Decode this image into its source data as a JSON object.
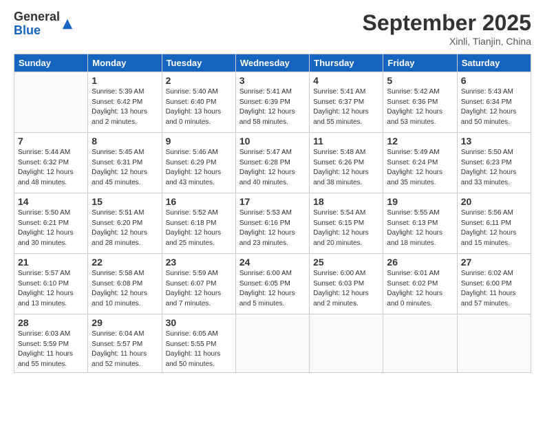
{
  "header": {
    "logo_line1": "General",
    "logo_line2": "Blue",
    "month": "September 2025",
    "location": "Xinli, Tianjin, China"
  },
  "weekdays": [
    "Sunday",
    "Monday",
    "Tuesday",
    "Wednesday",
    "Thursday",
    "Friday",
    "Saturday"
  ],
  "weeks": [
    [
      {
        "day": "",
        "info": ""
      },
      {
        "day": "1",
        "info": "Sunrise: 5:39 AM\nSunset: 6:42 PM\nDaylight: 13 hours\nand 2 minutes."
      },
      {
        "day": "2",
        "info": "Sunrise: 5:40 AM\nSunset: 6:40 PM\nDaylight: 13 hours\nand 0 minutes."
      },
      {
        "day": "3",
        "info": "Sunrise: 5:41 AM\nSunset: 6:39 PM\nDaylight: 12 hours\nand 58 minutes."
      },
      {
        "day": "4",
        "info": "Sunrise: 5:41 AM\nSunset: 6:37 PM\nDaylight: 12 hours\nand 55 minutes."
      },
      {
        "day": "5",
        "info": "Sunrise: 5:42 AM\nSunset: 6:36 PM\nDaylight: 12 hours\nand 53 minutes."
      },
      {
        "day": "6",
        "info": "Sunrise: 5:43 AM\nSunset: 6:34 PM\nDaylight: 12 hours\nand 50 minutes."
      }
    ],
    [
      {
        "day": "7",
        "info": "Sunrise: 5:44 AM\nSunset: 6:32 PM\nDaylight: 12 hours\nand 48 minutes."
      },
      {
        "day": "8",
        "info": "Sunrise: 5:45 AM\nSunset: 6:31 PM\nDaylight: 12 hours\nand 45 minutes."
      },
      {
        "day": "9",
        "info": "Sunrise: 5:46 AM\nSunset: 6:29 PM\nDaylight: 12 hours\nand 43 minutes."
      },
      {
        "day": "10",
        "info": "Sunrise: 5:47 AM\nSunset: 6:28 PM\nDaylight: 12 hours\nand 40 minutes."
      },
      {
        "day": "11",
        "info": "Sunrise: 5:48 AM\nSunset: 6:26 PM\nDaylight: 12 hours\nand 38 minutes."
      },
      {
        "day": "12",
        "info": "Sunrise: 5:49 AM\nSunset: 6:24 PM\nDaylight: 12 hours\nand 35 minutes."
      },
      {
        "day": "13",
        "info": "Sunrise: 5:50 AM\nSunset: 6:23 PM\nDaylight: 12 hours\nand 33 minutes."
      }
    ],
    [
      {
        "day": "14",
        "info": "Sunrise: 5:50 AM\nSunset: 6:21 PM\nDaylight: 12 hours\nand 30 minutes."
      },
      {
        "day": "15",
        "info": "Sunrise: 5:51 AM\nSunset: 6:20 PM\nDaylight: 12 hours\nand 28 minutes."
      },
      {
        "day": "16",
        "info": "Sunrise: 5:52 AM\nSunset: 6:18 PM\nDaylight: 12 hours\nand 25 minutes."
      },
      {
        "day": "17",
        "info": "Sunrise: 5:53 AM\nSunset: 6:16 PM\nDaylight: 12 hours\nand 23 minutes."
      },
      {
        "day": "18",
        "info": "Sunrise: 5:54 AM\nSunset: 6:15 PM\nDaylight: 12 hours\nand 20 minutes."
      },
      {
        "day": "19",
        "info": "Sunrise: 5:55 AM\nSunset: 6:13 PM\nDaylight: 12 hours\nand 18 minutes."
      },
      {
        "day": "20",
        "info": "Sunrise: 5:56 AM\nSunset: 6:11 PM\nDaylight: 12 hours\nand 15 minutes."
      }
    ],
    [
      {
        "day": "21",
        "info": "Sunrise: 5:57 AM\nSunset: 6:10 PM\nDaylight: 12 hours\nand 13 minutes."
      },
      {
        "day": "22",
        "info": "Sunrise: 5:58 AM\nSunset: 6:08 PM\nDaylight: 12 hours\nand 10 minutes."
      },
      {
        "day": "23",
        "info": "Sunrise: 5:59 AM\nSunset: 6:07 PM\nDaylight: 12 hours\nand 7 minutes."
      },
      {
        "day": "24",
        "info": "Sunrise: 6:00 AM\nSunset: 6:05 PM\nDaylight: 12 hours\nand 5 minutes."
      },
      {
        "day": "25",
        "info": "Sunrise: 6:00 AM\nSunset: 6:03 PM\nDaylight: 12 hours\nand 2 minutes."
      },
      {
        "day": "26",
        "info": "Sunrise: 6:01 AM\nSunset: 6:02 PM\nDaylight: 12 hours\nand 0 minutes."
      },
      {
        "day": "27",
        "info": "Sunrise: 6:02 AM\nSunset: 6:00 PM\nDaylight: 11 hours\nand 57 minutes."
      }
    ],
    [
      {
        "day": "28",
        "info": "Sunrise: 6:03 AM\nSunset: 5:59 PM\nDaylight: 11 hours\nand 55 minutes."
      },
      {
        "day": "29",
        "info": "Sunrise: 6:04 AM\nSunset: 5:57 PM\nDaylight: 11 hours\nand 52 minutes."
      },
      {
        "day": "30",
        "info": "Sunrise: 6:05 AM\nSunset: 5:55 PM\nDaylight: 11 hours\nand 50 minutes."
      },
      {
        "day": "",
        "info": ""
      },
      {
        "day": "",
        "info": ""
      },
      {
        "day": "",
        "info": ""
      },
      {
        "day": "",
        "info": ""
      }
    ]
  ]
}
